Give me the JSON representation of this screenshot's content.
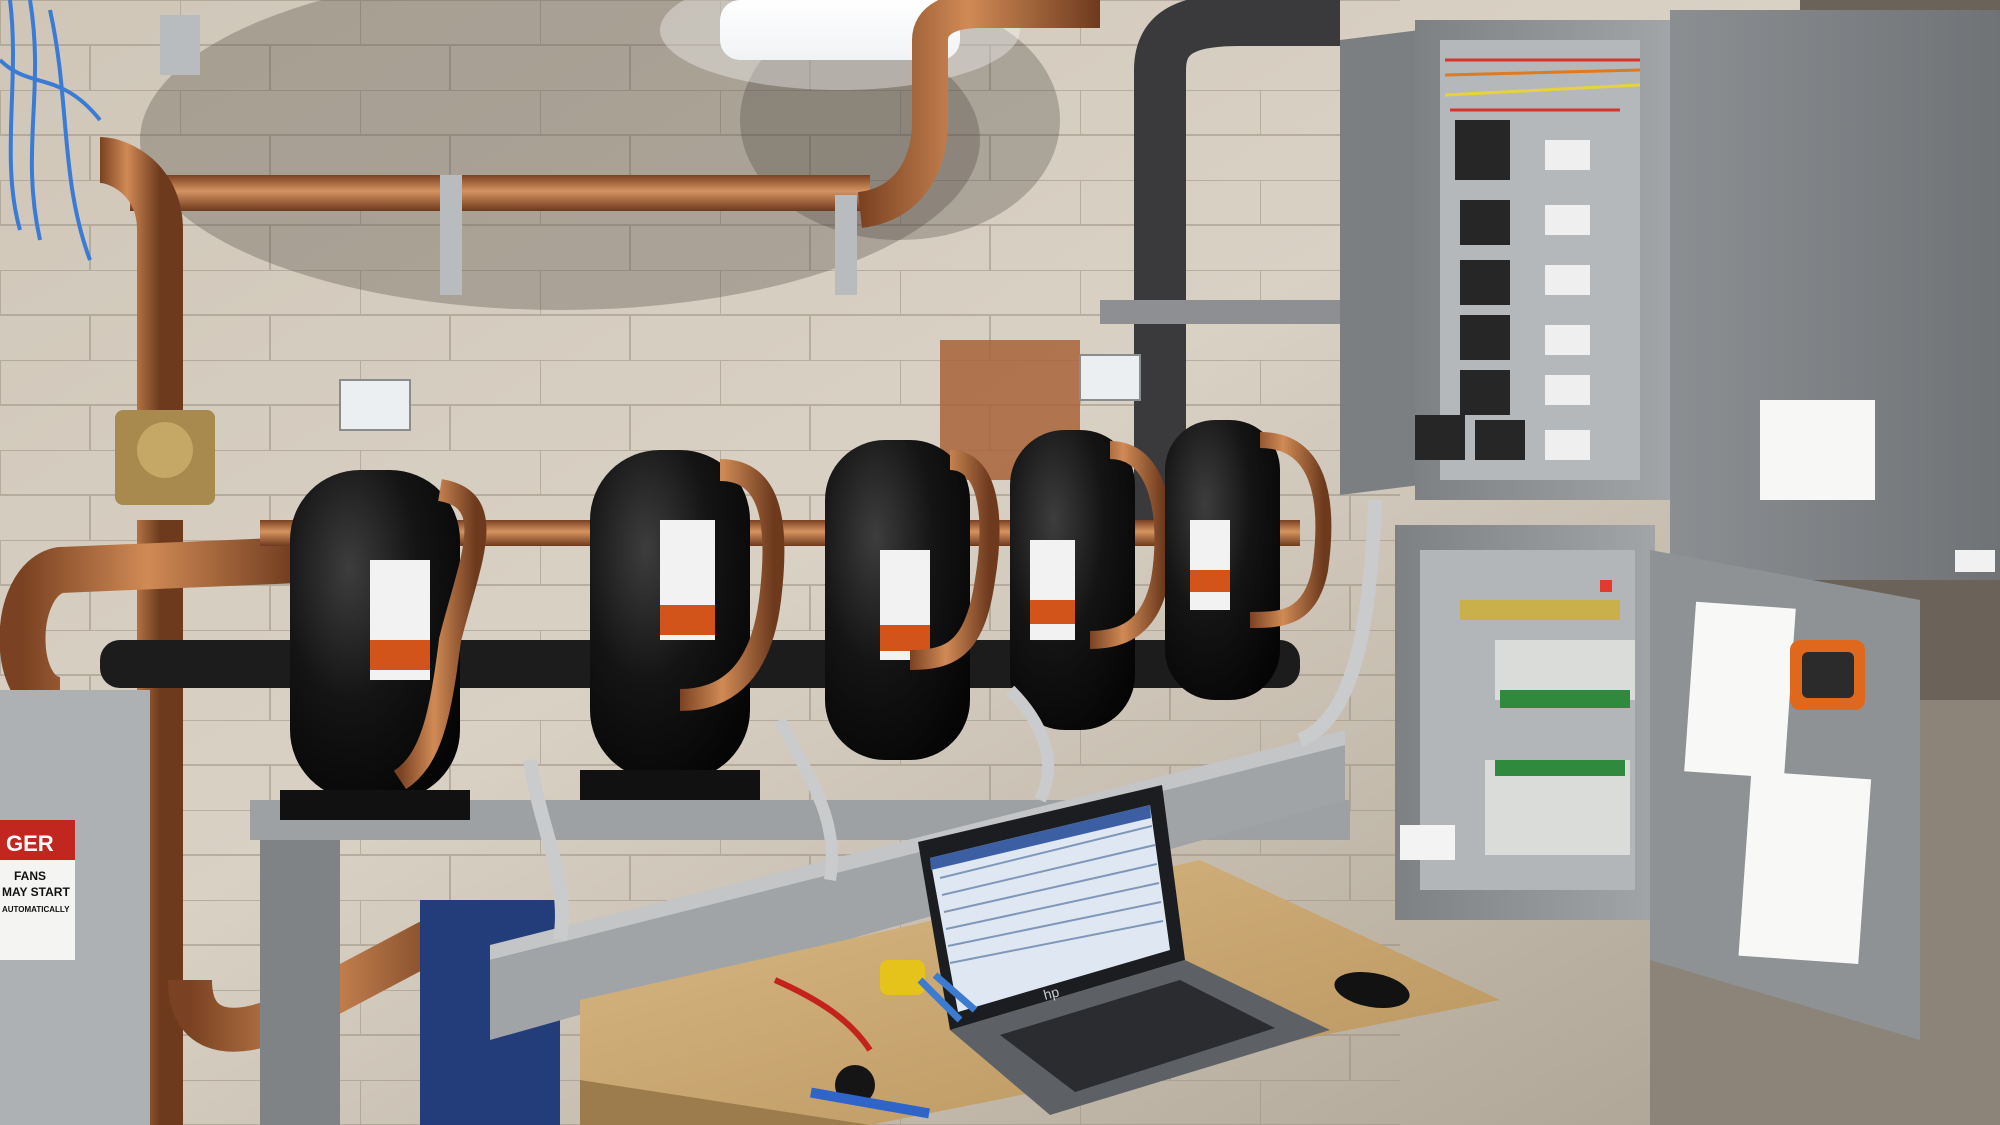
{
  "photo": {
    "subject": "compressor-rack-machine-room",
    "palette": {
      "wall": "#d9d0c3",
      "wall_shadow": "#8f8478",
      "copper": "#b8703f",
      "copper_dark": "#7a4222",
      "compressor_black": "#141414",
      "panel_gray": "#8e9193",
      "panel_dark": "#5f6366",
      "bench_wood": "#cfae7a",
      "laptop_screen": "#dfe8f2",
      "danger_red": "#c1261f"
    }
  },
  "danger_sign": {
    "header": "GER",
    "line1": "FANS",
    "line2": "MAY START",
    "line3": "AUTOMATICALLY"
  },
  "laptop": {
    "brand_logo": "hp"
  },
  "compressors": [
    {
      "id": "compressor-1"
    },
    {
      "id": "compressor-2"
    },
    {
      "id": "compressor-3"
    },
    {
      "id": "compressor-4"
    },
    {
      "id": "compressor-5"
    }
  ]
}
